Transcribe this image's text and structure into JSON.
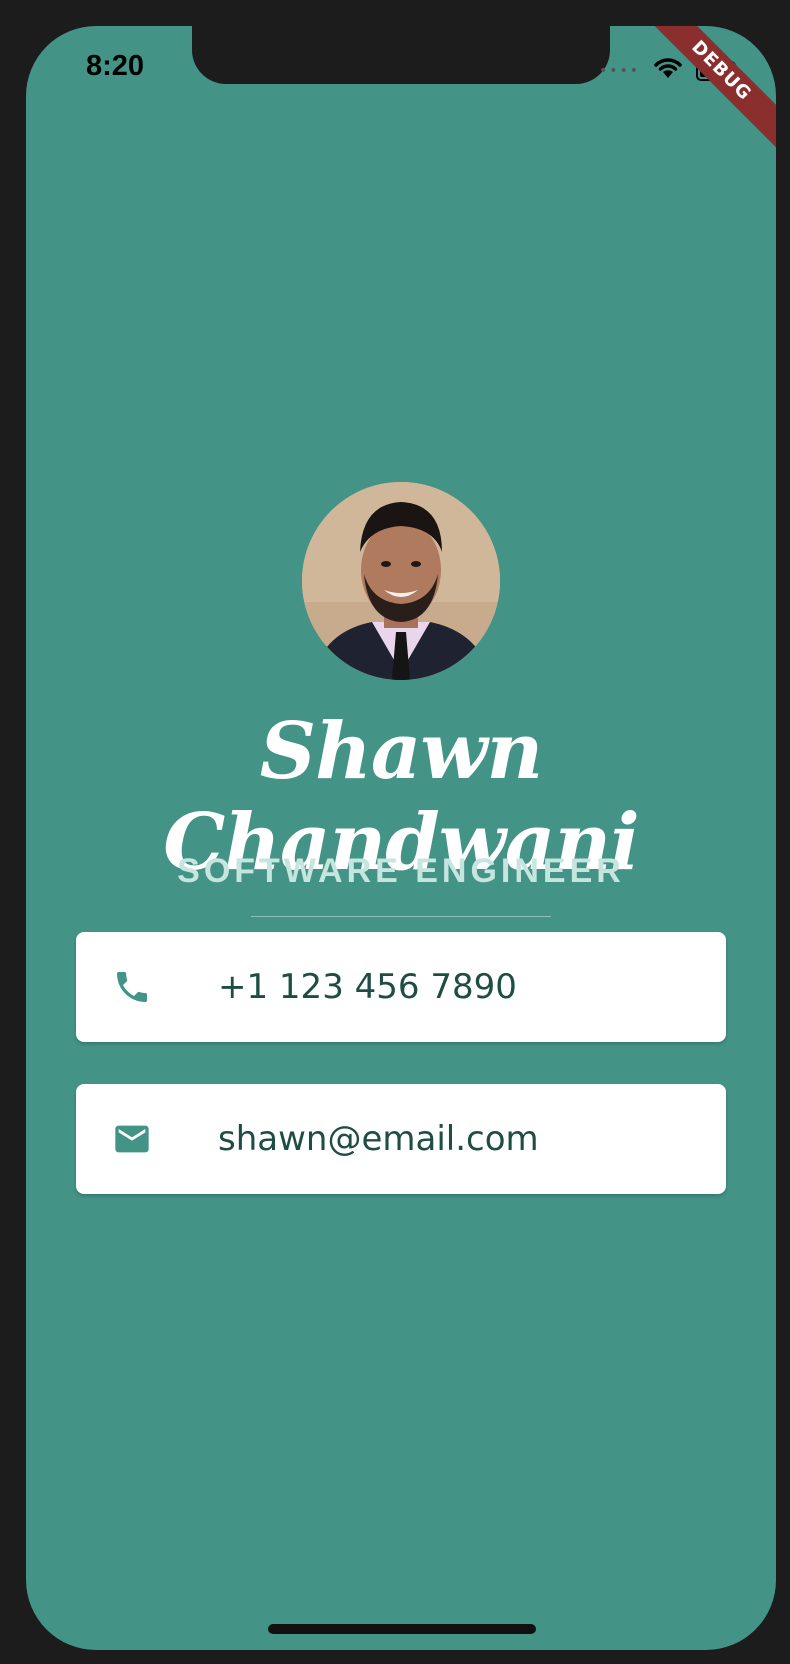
{
  "status_bar": {
    "time": "8:20",
    "signal_icon": "signal-dots-icon",
    "wifi_icon": "wifi-icon",
    "battery_icon": "battery-icon"
  },
  "debug_banner": "DEBUG",
  "profile": {
    "avatar_icon": "profile-photo",
    "name": "Shawn Chandwani",
    "title": "SOFTWARE ENGINEER"
  },
  "contacts": [
    {
      "icon": "phone-icon",
      "text": "+1 123 456 7890"
    },
    {
      "icon": "mail-icon",
      "text": "shawn@email.com"
    }
  ],
  "colors": {
    "background": "#439387",
    "card": "#ffffff",
    "icon": "#439387",
    "text": "#1e4d44",
    "subtitle": "#c6e5df"
  }
}
